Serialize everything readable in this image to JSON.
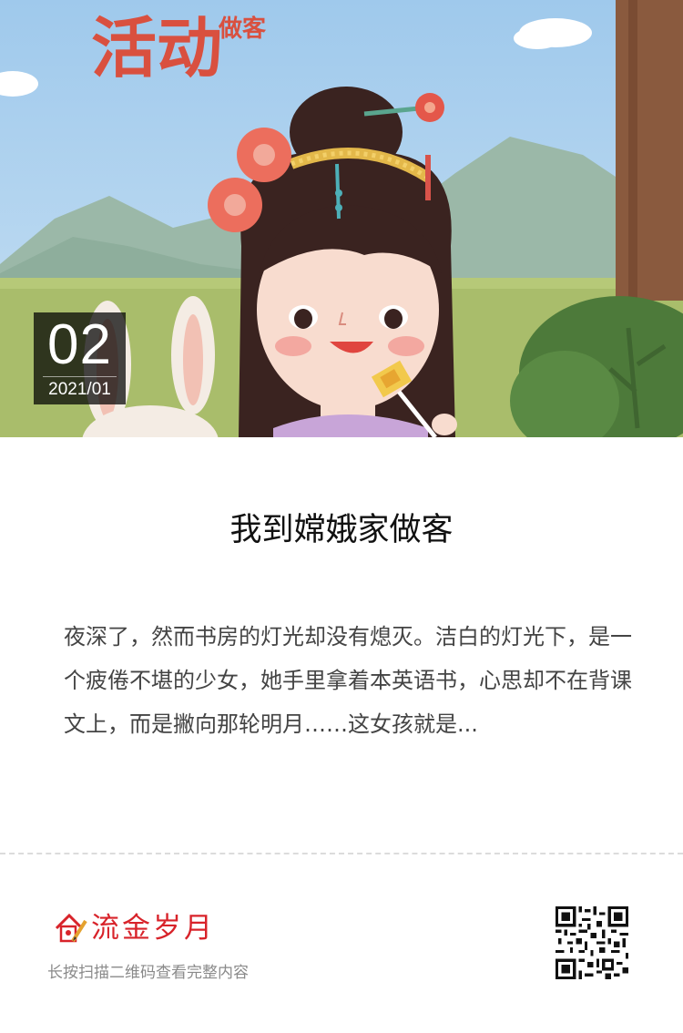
{
  "hero": {
    "poster_text_large": "活动",
    "poster_text_small": "做客",
    "date_badge": {
      "day": "02",
      "year_month": "2021/01"
    }
  },
  "article": {
    "title": "我到嫦娥家做客",
    "excerpt": "夜深了，然而书房的灯光却没有熄灭。洁白的灯光下，是一个疲倦不堪的少女，她手里拿着本英语书，心思却不在背课文上，而是撇向那轮明月……这女孩就是..."
  },
  "footer": {
    "brand_name": "流金岁月",
    "scan_hint": "长按扫描二维码查看完整内容",
    "qr_code_icon": "qr-code-icon",
    "brand_color": "#d8232a"
  }
}
